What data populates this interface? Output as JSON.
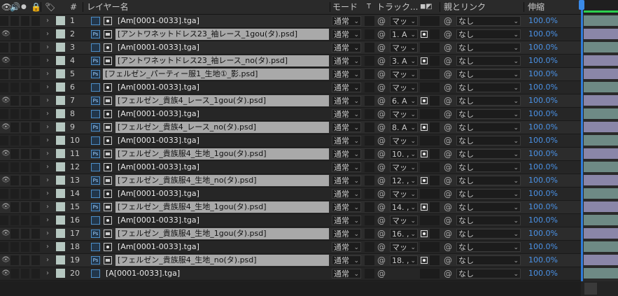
{
  "header": {
    "icons": [
      "eye-icon",
      "audio-icon",
      "solo-icon",
      "lock-icon",
      "label-icon"
    ],
    "num_label": "#",
    "layer_name": "レイヤー名",
    "mode": "モード",
    "t_col": "T",
    "track": "トラック...",
    "parent": "親とリンク",
    "stretch": "伸縮"
  },
  "layers": [
    {
      "num": "1",
      "name": "[Am[0001-0033].tga]",
      "type": "tga",
      "eye": false,
      "mode": "通常",
      "track": "マッ",
      "track_dot": false,
      "parent": "なし",
      "stretch": "100.0%"
    },
    {
      "num": "2",
      "name": "[アントワネットドレス23_袖レース_1gou(タ).psd]",
      "type": "psd",
      "eye": true,
      "mode": "通常",
      "track": "1. A",
      "track_dot": true,
      "parent": "なし",
      "stretch": "100.0%"
    },
    {
      "num": "3",
      "name": "[Am[0001-0033].tga]",
      "type": "tga",
      "eye": false,
      "mode": "通常",
      "track": "マッ",
      "track_dot": false,
      "parent": "なし",
      "stretch": "100.0%"
    },
    {
      "num": "4",
      "name": "[アントワネットドレス23_袖レース_no(タ).psd]",
      "type": "psd",
      "eye": true,
      "mode": "通常",
      "track": "3. A",
      "track_dot": true,
      "parent": "なし",
      "stretch": "100.0%"
    },
    {
      "num": "5",
      "name": "[フェルゼン_パーティー服1_生地①_影.psd]",
      "type": "psd5",
      "eye": false,
      "mode": "通常",
      "track": "マッ",
      "track_dot": false,
      "parent": "なし",
      "stretch": "100.0%"
    },
    {
      "num": "6",
      "name": "[Am[0001-0033].tga]",
      "type": "tga",
      "eye": false,
      "mode": "通常",
      "track": "マッ",
      "track_dot": false,
      "parent": "なし",
      "stretch": "100.0%"
    },
    {
      "num": "7",
      "name": "[フェルゼン_貴族4_レース_1gou(タ).psd]",
      "type": "psd",
      "eye": true,
      "mode": "通常",
      "track": "6. A",
      "track_dot": true,
      "parent": "なし",
      "stretch": "100.0%"
    },
    {
      "num": "8",
      "name": "[Am[0001-0033].tga]",
      "type": "tga",
      "eye": false,
      "mode": "通常",
      "track": "マッ",
      "track_dot": false,
      "parent": "なし",
      "stretch": "100.0%"
    },
    {
      "num": "9",
      "name": "[フェルゼン_貴族4_レース_no(タ).psd]",
      "type": "psd",
      "eye": true,
      "mode": "通常",
      "track": "8. A",
      "track_dot": true,
      "parent": "なし",
      "stretch": "100.0%"
    },
    {
      "num": "10",
      "name": "[Am[0001-0033].tga]",
      "type": "tga",
      "eye": false,
      "mode": "通常",
      "track": "マッ",
      "track_dot": false,
      "parent": "なし",
      "stretch": "100.0%"
    },
    {
      "num": "11",
      "name": "[フェルゼン_貴族服4_生地_1gou(タ).psd]",
      "type": "psd",
      "eye": true,
      "mode": "通常",
      "track": "10. ,",
      "track_dot": true,
      "parent": "なし",
      "stretch": "100.0%"
    },
    {
      "num": "12",
      "name": "[Am[0001-0033].tga]",
      "type": "tga",
      "eye": false,
      "mode": "通常",
      "track": "マッ",
      "track_dot": false,
      "parent": "なし",
      "stretch": "100.0%"
    },
    {
      "num": "13",
      "name": "[フェルゼン_貴族服4_生地_no(タ).psd]",
      "type": "psd",
      "eye": true,
      "mode": "通常",
      "track": "12. ,",
      "track_dot": true,
      "parent": "なし",
      "stretch": "100.0%"
    },
    {
      "num": "14",
      "name": "[Am[0001-0033].tga]",
      "type": "tga",
      "eye": false,
      "mode": "通常",
      "track": "マッ",
      "track_dot": false,
      "parent": "なし",
      "stretch": "100.0%"
    },
    {
      "num": "15",
      "name": "[フェルゼン_貴族服4_生地_1gou(タ).psd]",
      "type": "psd",
      "eye": true,
      "mode": "通常",
      "track": "14. ,",
      "track_dot": true,
      "parent": "なし",
      "stretch": "100.0%"
    },
    {
      "num": "16",
      "name": "[Am[0001-0033].tga]",
      "type": "tga",
      "eye": false,
      "mode": "通常",
      "track": "マッ",
      "track_dot": false,
      "parent": "なし",
      "stretch": "100.0%"
    },
    {
      "num": "17",
      "name": "[フェルゼン_貴族服4_生地_1gou(タ).psd]",
      "type": "psd",
      "eye": true,
      "mode": "通常",
      "track": "16. ,",
      "track_dot": true,
      "parent": "なし",
      "stretch": "100.0%"
    },
    {
      "num": "18",
      "name": "[Am[0001-0033].tga]",
      "type": "tga",
      "eye": false,
      "mode": "通常",
      "track": "マッ",
      "track_dot": false,
      "parent": "なし",
      "stretch": "100.0%"
    },
    {
      "num": "19",
      "name": "[フェルゼン_貴族服4_生地_no(タ).psd]",
      "type": "psd",
      "eye": true,
      "mode": "通常",
      "track": "18. ,",
      "track_dot": true,
      "parent": "なし",
      "stretch": "100.0%"
    },
    {
      "num": "20",
      "name": "[A[0001-0033].tga]",
      "type": "tga20",
      "eye": true,
      "mode": "通常",
      "track": "",
      "track_dot": false,
      "parent": "なし",
      "stretch": "100.0%"
    }
  ],
  "colors": {
    "label_color": "#b6c8c1",
    "stretch_blue": "#4b93e8",
    "psd_bg": "#a9a9a9",
    "timeline_green_bar": "#6e8a85",
    "timeline_purple_bar": "#8a86a8",
    "work_area_green": "#2bd04e",
    "playhead": "#2f7bd8"
  }
}
